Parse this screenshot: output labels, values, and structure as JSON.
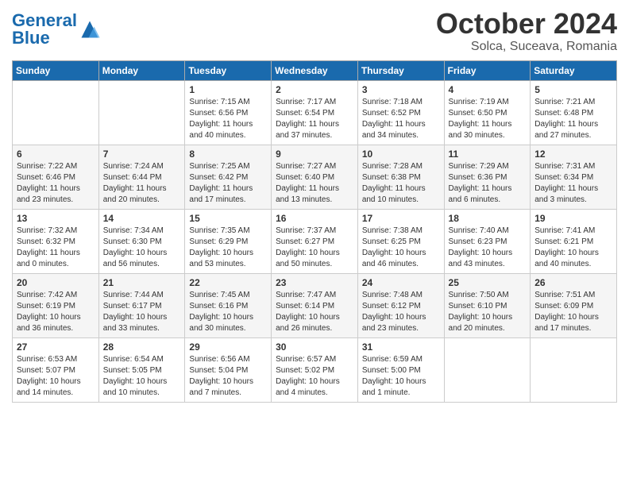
{
  "header": {
    "logo_general": "General",
    "logo_blue": "Blue",
    "month_title": "October 2024",
    "location": "Solca, Suceava, Romania"
  },
  "weekdays": [
    "Sunday",
    "Monday",
    "Tuesday",
    "Wednesday",
    "Thursday",
    "Friday",
    "Saturday"
  ],
  "weeks": [
    [
      {
        "day": "",
        "info": ""
      },
      {
        "day": "",
        "info": ""
      },
      {
        "day": "1",
        "info": "Sunrise: 7:15 AM\nSunset: 6:56 PM\nDaylight: 11 hours and 40 minutes."
      },
      {
        "day": "2",
        "info": "Sunrise: 7:17 AM\nSunset: 6:54 PM\nDaylight: 11 hours and 37 minutes."
      },
      {
        "day": "3",
        "info": "Sunrise: 7:18 AM\nSunset: 6:52 PM\nDaylight: 11 hours and 34 minutes."
      },
      {
        "day": "4",
        "info": "Sunrise: 7:19 AM\nSunset: 6:50 PM\nDaylight: 11 hours and 30 minutes."
      },
      {
        "day": "5",
        "info": "Sunrise: 7:21 AM\nSunset: 6:48 PM\nDaylight: 11 hours and 27 minutes."
      }
    ],
    [
      {
        "day": "6",
        "info": "Sunrise: 7:22 AM\nSunset: 6:46 PM\nDaylight: 11 hours and 23 minutes."
      },
      {
        "day": "7",
        "info": "Sunrise: 7:24 AM\nSunset: 6:44 PM\nDaylight: 11 hours and 20 minutes."
      },
      {
        "day": "8",
        "info": "Sunrise: 7:25 AM\nSunset: 6:42 PM\nDaylight: 11 hours and 17 minutes."
      },
      {
        "day": "9",
        "info": "Sunrise: 7:27 AM\nSunset: 6:40 PM\nDaylight: 11 hours and 13 minutes."
      },
      {
        "day": "10",
        "info": "Sunrise: 7:28 AM\nSunset: 6:38 PM\nDaylight: 11 hours and 10 minutes."
      },
      {
        "day": "11",
        "info": "Sunrise: 7:29 AM\nSunset: 6:36 PM\nDaylight: 11 hours and 6 minutes."
      },
      {
        "day": "12",
        "info": "Sunrise: 7:31 AM\nSunset: 6:34 PM\nDaylight: 11 hours and 3 minutes."
      }
    ],
    [
      {
        "day": "13",
        "info": "Sunrise: 7:32 AM\nSunset: 6:32 PM\nDaylight: 11 hours and 0 minutes."
      },
      {
        "day": "14",
        "info": "Sunrise: 7:34 AM\nSunset: 6:30 PM\nDaylight: 10 hours and 56 minutes."
      },
      {
        "day": "15",
        "info": "Sunrise: 7:35 AM\nSunset: 6:29 PM\nDaylight: 10 hours and 53 minutes."
      },
      {
        "day": "16",
        "info": "Sunrise: 7:37 AM\nSunset: 6:27 PM\nDaylight: 10 hours and 50 minutes."
      },
      {
        "day": "17",
        "info": "Sunrise: 7:38 AM\nSunset: 6:25 PM\nDaylight: 10 hours and 46 minutes."
      },
      {
        "day": "18",
        "info": "Sunrise: 7:40 AM\nSunset: 6:23 PM\nDaylight: 10 hours and 43 minutes."
      },
      {
        "day": "19",
        "info": "Sunrise: 7:41 AM\nSunset: 6:21 PM\nDaylight: 10 hours and 40 minutes."
      }
    ],
    [
      {
        "day": "20",
        "info": "Sunrise: 7:42 AM\nSunset: 6:19 PM\nDaylight: 10 hours and 36 minutes."
      },
      {
        "day": "21",
        "info": "Sunrise: 7:44 AM\nSunset: 6:17 PM\nDaylight: 10 hours and 33 minutes."
      },
      {
        "day": "22",
        "info": "Sunrise: 7:45 AM\nSunset: 6:16 PM\nDaylight: 10 hours and 30 minutes."
      },
      {
        "day": "23",
        "info": "Sunrise: 7:47 AM\nSunset: 6:14 PM\nDaylight: 10 hours and 26 minutes."
      },
      {
        "day": "24",
        "info": "Sunrise: 7:48 AM\nSunset: 6:12 PM\nDaylight: 10 hours and 23 minutes."
      },
      {
        "day": "25",
        "info": "Sunrise: 7:50 AM\nSunset: 6:10 PM\nDaylight: 10 hours and 20 minutes."
      },
      {
        "day": "26",
        "info": "Sunrise: 7:51 AM\nSunset: 6:09 PM\nDaylight: 10 hours and 17 minutes."
      }
    ],
    [
      {
        "day": "27",
        "info": "Sunrise: 6:53 AM\nSunset: 5:07 PM\nDaylight: 10 hours and 14 minutes."
      },
      {
        "day": "28",
        "info": "Sunrise: 6:54 AM\nSunset: 5:05 PM\nDaylight: 10 hours and 10 minutes."
      },
      {
        "day": "29",
        "info": "Sunrise: 6:56 AM\nSunset: 5:04 PM\nDaylight: 10 hours and 7 minutes."
      },
      {
        "day": "30",
        "info": "Sunrise: 6:57 AM\nSunset: 5:02 PM\nDaylight: 10 hours and 4 minutes."
      },
      {
        "day": "31",
        "info": "Sunrise: 6:59 AM\nSunset: 5:00 PM\nDaylight: 10 hours and 1 minute."
      },
      {
        "day": "",
        "info": ""
      },
      {
        "day": "",
        "info": ""
      }
    ]
  ]
}
